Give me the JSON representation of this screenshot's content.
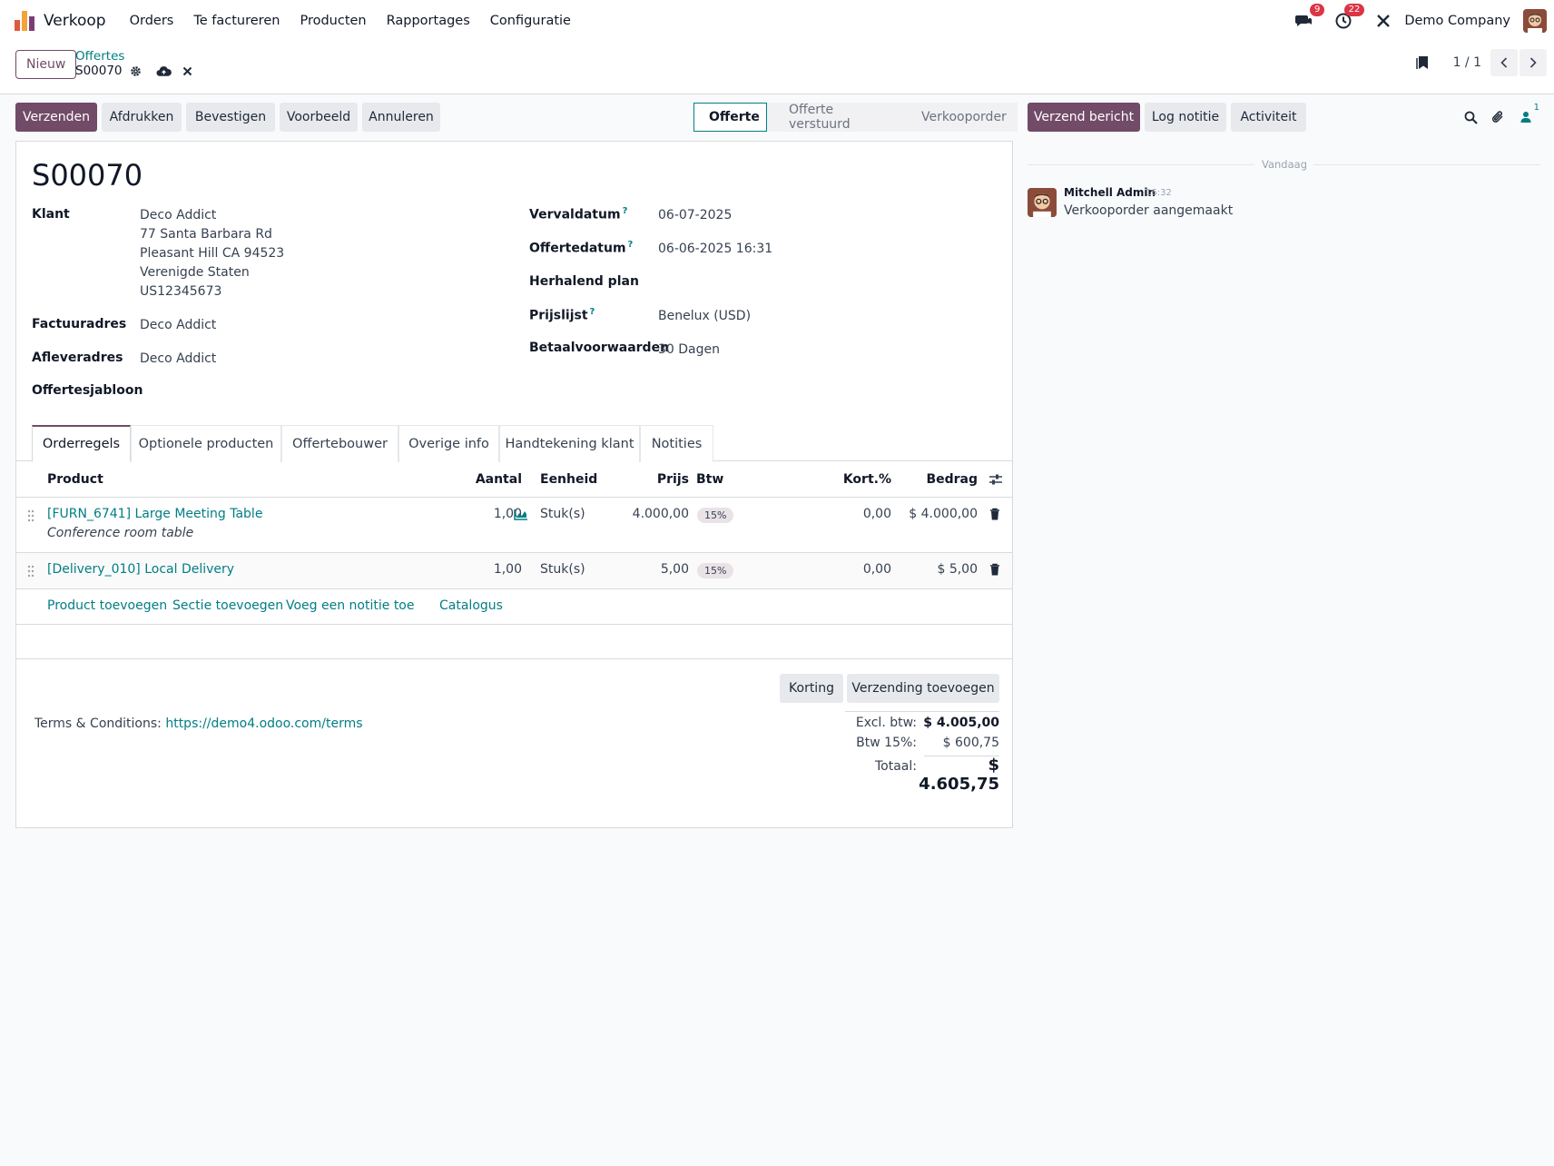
{
  "navbar": {
    "app_name": "Verkoop",
    "menu": [
      "Orders",
      "Te factureren",
      "Producten",
      "Rapportages",
      "Configuratie"
    ],
    "messages_count": "9",
    "activities_count": "22",
    "company": "Demo Company"
  },
  "control": {
    "new_label": "Nieuw",
    "breadcrumb_parent": "Offertes",
    "breadcrumb_current": "S00070",
    "pager": "1 / 1"
  },
  "actions": {
    "send": "Verzenden",
    "print": "Afdrukken",
    "confirm": "Bevestigen",
    "preview": "Voorbeeld",
    "cancel": "Annuleren"
  },
  "status": {
    "stages": [
      "Offerte",
      "Offerte verstuurd",
      "Verkooporder"
    ],
    "active": "Offerte"
  },
  "form": {
    "title": "S00070",
    "customer_label": "Klant",
    "customer_lines": [
      "Deco Addict",
      "77 Santa Barbara Rd",
      "Pleasant Hill CA 94523",
      "Verenigde Staten",
      "US12345673"
    ],
    "invoice_label": "Factuuradres",
    "invoice_value": "Deco Addict",
    "delivery_label": "Afleveradres",
    "delivery_value": "Deco Addict",
    "template_label": "Offertesjabloon",
    "expiry_label": "Vervaldatum",
    "expiry_value": "06-07-2025",
    "quote_date_label": "Offertedatum",
    "quote_date_value": "06-06-2025 16:31",
    "recurring_label": "Herhalend plan",
    "pricelist_label": "Prijslijst",
    "pricelist_value": "Benelux (USD)",
    "payment_label": "Betaalvoorwaarden",
    "payment_value": "30 Dagen",
    "help_mark": "?"
  },
  "tabs": [
    "Orderregels",
    "Optionele producten",
    "Offertebouwer",
    "Overige info",
    "Handtekening klant",
    "Notities"
  ],
  "table": {
    "headers": {
      "product": "Product",
      "qty": "Aantal",
      "unit": "Eenheid",
      "price": "Prijs",
      "tax": "Btw",
      "discount": "Kort.%",
      "amount": "Bedrag"
    },
    "rows": [
      {
        "product": "[FURN_6741] Large Meeting Table",
        "description": "Conference room table",
        "qty": "1,00",
        "unit": "Stuk(s)",
        "price": "4.000,00",
        "tax": "15%",
        "discount": "0,00",
        "amount": "$ 4.000,00"
      },
      {
        "product": "[Delivery_010] Local Delivery",
        "description": "",
        "qty": "1,00",
        "unit": "Stuk(s)",
        "price": "5,00",
        "tax": "15%",
        "discount": "0,00",
        "amount": "$ 5,00"
      }
    ],
    "add_product": "Product toevoegen",
    "add_section": "Sectie toevoegen",
    "add_note": "Voeg een notitie toe",
    "catalog": "Catalogus"
  },
  "footer": {
    "discount_btn": "Korting",
    "shipping_btn": "Verzending toevoegen",
    "terms_prefix": "Terms & Conditions:",
    "terms_link": "https://demo4.odoo.com/terms",
    "untaxed_label": "Excl. btw:",
    "untaxed_value": "$ 4.005,00",
    "tax_label": "Btw 15%:",
    "tax_value": "$ 600,75",
    "total_label": "Totaal:",
    "total_value": "$ 4.605,75"
  },
  "chatter": {
    "send_message": "Verzend bericht",
    "log_note": "Log notitie",
    "activity": "Activiteit",
    "followers_count": "1",
    "date_separator": "Vandaag",
    "messages": [
      {
        "author": "Mitchell Admin",
        "time": "16:32",
        "body": "Verkooporder aangemaakt"
      }
    ]
  },
  "colors": {
    "primary": "#714b67",
    "link": "#017e84",
    "badge": "#dc3545"
  }
}
